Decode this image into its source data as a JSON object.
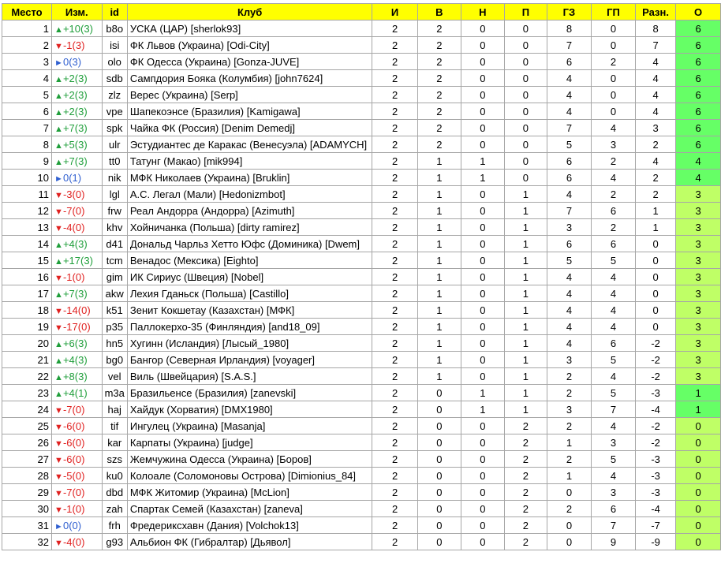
{
  "colors": {
    "header_bg": "#ffff00",
    "pts_high": "#66ff66",
    "pts_mid": "#bfff66",
    "pts_low": "#d9ff66",
    "up": "#1f9e3a",
    "down": "#e0201f",
    "flat": "#2f5fd0"
  },
  "headers": [
    "Место",
    "Изм.",
    "id",
    "Клуб",
    "И",
    "В",
    "Н",
    "П",
    "ГЗ",
    "ГП",
    "Разн.",
    "О"
  ],
  "rows": [
    {
      "place": "1",
      "dir": "up",
      "chg": "+10(3)",
      "id": "b8o",
      "club": "УСКА (ЦАР) [sherlok93]",
      "i": "2",
      "w": "2",
      "d": "0",
      "l": "0",
      "gf": "8",
      "ga": "0",
      "diff": "8",
      "pts": "6"
    },
    {
      "place": "2",
      "dir": "down",
      "chg": "-1(3)",
      "id": "isi",
      "club": "ФК Львов (Украина) [Odi-City]",
      "i": "2",
      "w": "2",
      "d": "0",
      "l": "0",
      "gf": "7",
      "ga": "0",
      "diff": "7",
      "pts": "6"
    },
    {
      "place": "3",
      "dir": "flat",
      "chg": "0(3)",
      "id": "olo",
      "club": "ФК Одесса (Украина) [Gonza-JUVE]",
      "i": "2",
      "w": "2",
      "d": "0",
      "l": "0",
      "gf": "6",
      "ga": "2",
      "diff": "4",
      "pts": "6"
    },
    {
      "place": "4",
      "dir": "up",
      "chg": "+2(3)",
      "id": "sdb",
      "club": "Сампдория Бояка (Колумбия) [john7624]",
      "i": "2",
      "w": "2",
      "d": "0",
      "l": "0",
      "gf": "4",
      "ga": "0",
      "diff": "4",
      "pts": "6"
    },
    {
      "place": "5",
      "dir": "up",
      "chg": "+2(3)",
      "id": "zlz",
      "club": "Верес (Украина) [Serp]",
      "i": "2",
      "w": "2",
      "d": "0",
      "l": "0",
      "gf": "4",
      "ga": "0",
      "diff": "4",
      "pts": "6"
    },
    {
      "place": "6",
      "dir": "up",
      "chg": "+2(3)",
      "id": "vpe",
      "club": "Шапекоэнсе (Бразилия) [Kamigawa]",
      "i": "2",
      "w": "2",
      "d": "0",
      "l": "0",
      "gf": "4",
      "ga": "0",
      "diff": "4",
      "pts": "6"
    },
    {
      "place": "7",
      "dir": "up",
      "chg": "+7(3)",
      "id": "spk",
      "club": "Чайка ФК (Россия) [Denim Demedj]",
      "i": "2",
      "w": "2",
      "d": "0",
      "l": "0",
      "gf": "7",
      "ga": "4",
      "diff": "3",
      "pts": "6"
    },
    {
      "place": "8",
      "dir": "up",
      "chg": "+5(3)",
      "id": "ulr",
      "club": "Эстудиантес де Каракас (Венесуэла) [ADAMYCH]",
      "i": "2",
      "w": "2",
      "d": "0",
      "l": "0",
      "gf": "5",
      "ga": "3",
      "diff": "2",
      "pts": "6"
    },
    {
      "place": "9",
      "dir": "up",
      "chg": "+7(3)",
      "id": "tt0",
      "club": "Татунг (Макао) [mik994]",
      "i": "2",
      "w": "1",
      "d": "1",
      "l": "0",
      "gf": "6",
      "ga": "2",
      "diff": "4",
      "pts": "4"
    },
    {
      "place": "10",
      "dir": "flat",
      "chg": "0(1)",
      "id": "nik",
      "club": "МФК Николаев (Украина) [Bruklin]",
      "i": "2",
      "w": "1",
      "d": "1",
      "l": "0",
      "gf": "6",
      "ga": "4",
      "diff": "2",
      "pts": "4"
    },
    {
      "place": "11",
      "dir": "down",
      "chg": "-3(0)",
      "id": "lgl",
      "club": "А.С. Легал (Мали) [Hedonizmbot]",
      "i": "2",
      "w": "1",
      "d": "0",
      "l": "1",
      "gf": "4",
      "ga": "2",
      "diff": "2",
      "pts": "3"
    },
    {
      "place": "12",
      "dir": "down",
      "chg": "-7(0)",
      "id": "frw",
      "club": "Реал Андорра (Андорра) [Azimuth]",
      "i": "2",
      "w": "1",
      "d": "0",
      "l": "1",
      "gf": "7",
      "ga": "6",
      "diff": "1",
      "pts": "3"
    },
    {
      "place": "13",
      "dir": "down",
      "chg": "-4(0)",
      "id": "khv",
      "club": "Хойничанка (Польша) [dirty ramirez]",
      "i": "2",
      "w": "1",
      "d": "0",
      "l": "1",
      "gf": "3",
      "ga": "2",
      "diff": "1",
      "pts": "3"
    },
    {
      "place": "14",
      "dir": "up",
      "chg": "+4(3)",
      "id": "d41",
      "club": "Дональд Чарльз Хетто Юфс (Доминика) [Dwem]",
      "i": "2",
      "w": "1",
      "d": "0",
      "l": "1",
      "gf": "6",
      "ga": "6",
      "diff": "0",
      "pts": "3"
    },
    {
      "place": "15",
      "dir": "up",
      "chg": "+17(3)",
      "id": "tcm",
      "club": "Венадос (Мексика) [Eighto]",
      "i": "2",
      "w": "1",
      "d": "0",
      "l": "1",
      "gf": "5",
      "ga": "5",
      "diff": "0",
      "pts": "3"
    },
    {
      "place": "16",
      "dir": "down",
      "chg": "-1(0)",
      "id": "gim",
      "club": "ИК Сириус (Швеция) [Nobel]",
      "i": "2",
      "w": "1",
      "d": "0",
      "l": "1",
      "gf": "4",
      "ga": "4",
      "diff": "0",
      "pts": "3"
    },
    {
      "place": "17",
      "dir": "up",
      "chg": "+7(3)",
      "id": "akw",
      "club": "Лехия Гданьск (Польша) [Castillo]",
      "i": "2",
      "w": "1",
      "d": "0",
      "l": "1",
      "gf": "4",
      "ga": "4",
      "diff": "0",
      "pts": "3"
    },
    {
      "place": "18",
      "dir": "down",
      "chg": "-14(0)",
      "id": "k51",
      "club": "Зенит Кокшетау (Казахстан) [МФК]",
      "i": "2",
      "w": "1",
      "d": "0",
      "l": "1",
      "gf": "4",
      "ga": "4",
      "diff": "0",
      "pts": "3"
    },
    {
      "place": "19",
      "dir": "down",
      "chg": "-17(0)",
      "id": "p35",
      "club": "Паллокерхо-35 (Финляндия) [and18_09]",
      "i": "2",
      "w": "1",
      "d": "0",
      "l": "1",
      "gf": "4",
      "ga": "4",
      "diff": "0",
      "pts": "3"
    },
    {
      "place": "20",
      "dir": "up",
      "chg": "+6(3)",
      "id": "hn5",
      "club": "Хугинн (Исландия) [Лысый_1980]",
      "i": "2",
      "w": "1",
      "d": "0",
      "l": "1",
      "gf": "4",
      "ga": "6",
      "diff": "-2",
      "pts": "3"
    },
    {
      "place": "21",
      "dir": "up",
      "chg": "+4(3)",
      "id": "bg0",
      "club": "Бангор (Северная Ирландия) [voyager]",
      "i": "2",
      "w": "1",
      "d": "0",
      "l": "1",
      "gf": "3",
      "ga": "5",
      "diff": "-2",
      "pts": "3"
    },
    {
      "place": "22",
      "dir": "up",
      "chg": "+8(3)",
      "id": "vel",
      "club": "Виль (Швейцария) [S.A.S.]",
      "i": "2",
      "w": "1",
      "d": "0",
      "l": "1",
      "gf": "2",
      "ga": "4",
      "diff": "-2",
      "pts": "3"
    },
    {
      "place": "23",
      "dir": "up",
      "chg": "+4(1)",
      "id": "m3a",
      "club": "Бразильенсе (Бразилия) [zanevski]",
      "i": "2",
      "w": "0",
      "d": "1",
      "l": "1",
      "gf": "2",
      "ga": "5",
      "diff": "-3",
      "pts": "1"
    },
    {
      "place": "24",
      "dir": "down",
      "chg": "-7(0)",
      "id": "haj",
      "club": "Хайдук (Хорватия) [DMX1980]",
      "i": "2",
      "w": "0",
      "d": "1",
      "l": "1",
      "gf": "3",
      "ga": "7",
      "diff": "-4",
      "pts": "1"
    },
    {
      "place": "25",
      "dir": "down",
      "chg": "-6(0)",
      "id": "tif",
      "club": "Ингулец (Украина) [Masanja]",
      "i": "2",
      "w": "0",
      "d": "0",
      "l": "2",
      "gf": "2",
      "ga": "4",
      "diff": "-2",
      "pts": "0"
    },
    {
      "place": "26",
      "dir": "down",
      "chg": "-6(0)",
      "id": "kar",
      "club": "Карпаты (Украина) [judge]",
      "i": "2",
      "w": "0",
      "d": "0",
      "l": "2",
      "gf": "1",
      "ga": "3",
      "diff": "-2",
      "pts": "0"
    },
    {
      "place": "27",
      "dir": "down",
      "chg": "-6(0)",
      "id": "szs",
      "club": "Жемчужина Одесса (Украина) [Боров]",
      "i": "2",
      "w": "0",
      "d": "0",
      "l": "2",
      "gf": "2",
      "ga": "5",
      "diff": "-3",
      "pts": "0"
    },
    {
      "place": "28",
      "dir": "down",
      "chg": "-5(0)",
      "id": "ku0",
      "club": "Колоале (Соломоновы Острова) [Dimionius_84]",
      "i": "2",
      "w": "0",
      "d": "0",
      "l": "2",
      "gf": "1",
      "ga": "4",
      "diff": "-3",
      "pts": "0"
    },
    {
      "place": "29",
      "dir": "down",
      "chg": "-7(0)",
      "id": "dbd",
      "club": "МФК Житомир (Украина) [McLion]",
      "i": "2",
      "w": "0",
      "d": "0",
      "l": "2",
      "gf": "0",
      "ga": "3",
      "diff": "-3",
      "pts": "0"
    },
    {
      "place": "30",
      "dir": "down",
      "chg": "-1(0)",
      "id": "zah",
      "club": "Спартак Семей (Казахстан) [zaneva]",
      "i": "2",
      "w": "0",
      "d": "0",
      "l": "2",
      "gf": "2",
      "ga": "6",
      "diff": "-4",
      "pts": "0"
    },
    {
      "place": "31",
      "dir": "flat",
      "chg": "0(0)",
      "id": "frh",
      "club": "Фредериксхавн (Дания) [Volchok13]",
      "i": "2",
      "w": "0",
      "d": "0",
      "l": "2",
      "gf": "0",
      "ga": "7",
      "diff": "-7",
      "pts": "0"
    },
    {
      "place": "32",
      "dir": "down",
      "chg": "-4(0)",
      "id": "g93",
      "club": "Альбион ФК (Гибралтар) [Дьявол]",
      "i": "2",
      "w": "0",
      "d": "0",
      "l": "2",
      "gf": "0",
      "ga": "9",
      "diff": "-9",
      "pts": "0"
    }
  ]
}
